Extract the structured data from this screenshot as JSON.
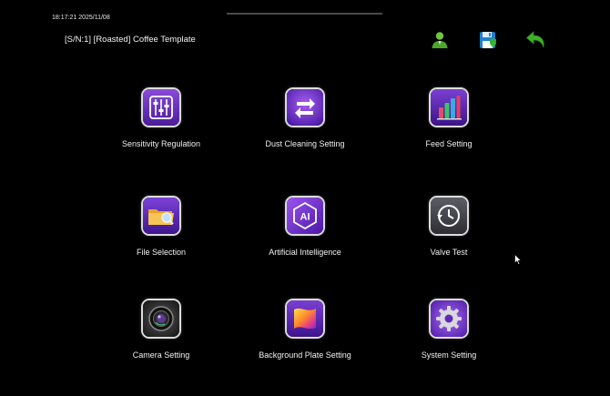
{
  "header": {
    "timestamp": "18:17:21 2025/11/08",
    "title": "[S/N:1] [Roasted] Coffee Template"
  },
  "toolbar": [
    {
      "name": "user-button",
      "icon": "user-icon"
    },
    {
      "name": "save-button",
      "icon": "save-icon"
    },
    {
      "name": "back-button",
      "icon": "back-arrow-icon"
    }
  ],
  "tiles": [
    {
      "label": "Sensitivity Regulation",
      "icon": "sliders-icon"
    },
    {
      "label": "Dust Cleaning Setting",
      "icon": "refresh-arrows-icon"
    },
    {
      "label": "Feed Setting",
      "icon": "bar-chart-icon"
    },
    {
      "label": "File Selection",
      "icon": "folder-search-icon"
    },
    {
      "label": "Artificial Intelligence",
      "icon": "ai-chip-icon"
    },
    {
      "label": "Valve Test",
      "icon": "history-clock-icon"
    },
    {
      "label": "Camera Setting",
      "icon": "camera-lens-icon"
    },
    {
      "label": "Background Plate Setting",
      "icon": "color-plate-icon"
    },
    {
      "label": "System Setting",
      "icon": "gear-icon"
    }
  ],
  "colors": {
    "background": "#000000",
    "icon_purple": "#6a2bc4",
    "user_green": "#59b934",
    "save_blue": "#1f7fd0",
    "back_green": "#3fae2a"
  }
}
